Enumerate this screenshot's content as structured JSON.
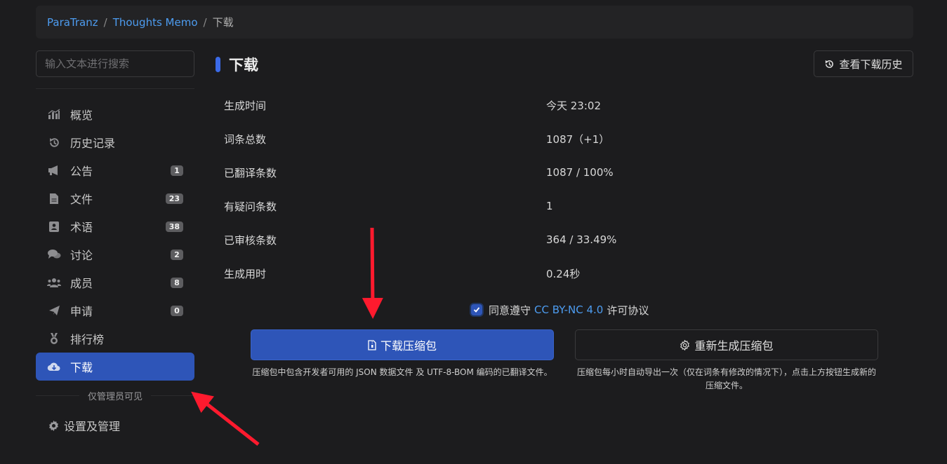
{
  "breadcrumb": {
    "root": "ParaTranz",
    "project": "Thoughts Memo",
    "current": "下载",
    "separator": "/"
  },
  "sidebar": {
    "search_placeholder": "输入文本进行搜索",
    "items": [
      {
        "label": "概览",
        "icon": "chart-icon",
        "badge": ""
      },
      {
        "label": "历史记录",
        "icon": "history-icon",
        "badge": ""
      },
      {
        "label": "公告",
        "icon": "megaphone-icon",
        "badge": "1"
      },
      {
        "label": "文件",
        "icon": "file-icon",
        "badge": "23"
      },
      {
        "label": "术语",
        "icon": "book-icon",
        "badge": "38"
      },
      {
        "label": "讨论",
        "icon": "comments-icon",
        "badge": "2"
      },
      {
        "label": "成员",
        "icon": "users-icon",
        "badge": "8"
      },
      {
        "label": "申请",
        "icon": "paper-plane-icon",
        "badge": "0"
      },
      {
        "label": "排行榜",
        "icon": "medal-icon",
        "badge": ""
      },
      {
        "label": "下载",
        "icon": "cloud-download-icon",
        "badge": "",
        "active": true
      }
    ],
    "admin_label": "仅管理员可见",
    "settings_label": "设置及管理"
  },
  "main": {
    "title": "下载",
    "history_button": "查看下载历史",
    "stats": [
      {
        "key": "生成时间",
        "value": "今天 23:02"
      },
      {
        "key": "词条总数",
        "value": "1087（+1）"
      },
      {
        "key": "已翻译条数",
        "value": "1087 / 100%"
      },
      {
        "key": "有疑问条数",
        "value": "1"
      },
      {
        "key": "已审核条数",
        "value": "364 / 33.49%"
      },
      {
        "key": "生成用时",
        "value": "0.24秒"
      }
    ],
    "agree": {
      "prefix": "同意遵守",
      "license": "CC BY-NC 4.0",
      "suffix": "许可协议",
      "checked": true
    },
    "download_button": "下载压缩包",
    "regenerate_button": "重新生成压缩包",
    "download_note": "压缩包中包含开发者可用的 JSON 数据文件 及 UTF-8-BOM 编码的已翻译文件。",
    "regenerate_note": "压缩包每小时自动导出一次（仅在词条有修改的情况下），点击上方按钮生成新的压缩文件。"
  },
  "colors": {
    "accent": "#2e55b8",
    "link": "#4d9cf0",
    "background": "#1c1c1e",
    "annotation_arrow": "#ff1a2e"
  }
}
